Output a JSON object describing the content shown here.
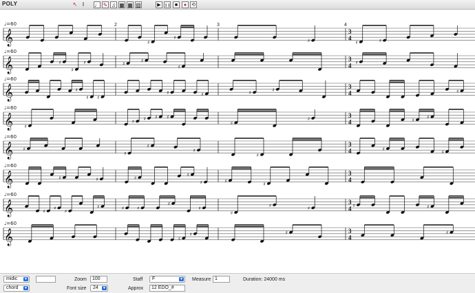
{
  "app_title": "POLY",
  "toolbar": {
    "tools": [
      {
        "icon": "arrow-pointer-icon",
        "glyph": "↖",
        "color": "#c2182a"
      },
      {
        "icon": "text-cursor-icon",
        "glyph": "I",
        "color": "#111111"
      },
      {
        "icon": "quarter-note-icon",
        "glyph": "♩",
        "color": "#111111"
      },
      {
        "icon": "pencil-icon",
        "glyph": "✎",
        "color": "#c2182a"
      },
      {
        "icon": "eighth-notes-icon",
        "glyph": "♫",
        "color": "#111111"
      },
      {
        "icon": "grid-icon",
        "glyph": "▦",
        "color": "#111111"
      },
      {
        "icon": "grid-alt-icon",
        "glyph": "▦",
        "color": "#111111"
      },
      {
        "icon": "grid-edit-icon",
        "glyph": "▧",
        "color": "#111111"
      }
    ],
    "transport": [
      {
        "icon": "play-icon",
        "glyph": "▶"
      },
      {
        "icon": "pause-icon",
        "glyph": "❙❙"
      },
      {
        "icon": "stop-icon",
        "glyph": "■"
      },
      {
        "icon": "record-icon",
        "glyph": "●"
      },
      {
        "icon": "loop-icon",
        "glyph": "⟲"
      }
    ]
  },
  "score": {
    "tempo_marking": "♩=60",
    "measure_numbers": [
      "2",
      "3",
      "4"
    ],
    "time_signature": [
      "3",
      "4"
    ],
    "staves": 8
  },
  "controls": {
    "midi_select": "midic",
    "mode_select": "chord",
    "zoom_label": "Zoom",
    "zoom_value": "100",
    "fontsize_label": "Font size",
    "fontsize_value": "24",
    "staff_label": "Staff",
    "staff_value": "F",
    "approx_label": "Approx",
    "approx_value": "12 EDO_#",
    "measure_label": "Measure",
    "measure_value": "1",
    "duration_text": "Duration: 24000 ms"
  },
  "colors": {
    "accent": "#2a6fdb",
    "record": "#c2182a",
    "toolbar_bg": "#e3e3e3",
    "panel_bg": "#eeeeee"
  }
}
